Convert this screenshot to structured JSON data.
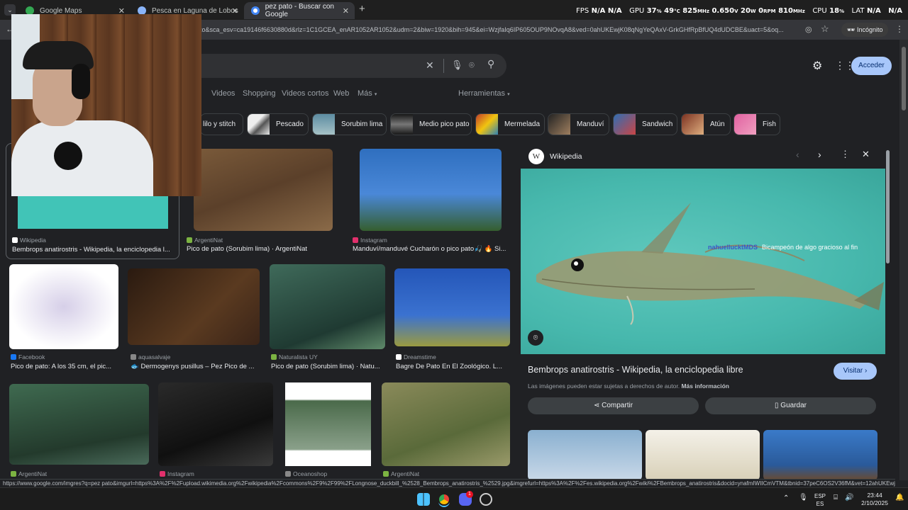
{
  "tabs": [
    {
      "title": "Google Maps",
      "active": false
    },
    {
      "title": "Pesca en Laguna de Lobos",
      "active": false
    },
    {
      "title": "pez pato - Buscar con Google",
      "active": true
    }
  ],
  "perf_overlay": {
    "fps_label": "FPS",
    "fps_val1": "N/A",
    "fps_val2": "N/A",
    "gpu_label": "GPU",
    "gpu_load": "37",
    "gpu_temp": "49",
    "gpu_clock": "825",
    "gpu_volt": "0.650",
    "gpu_power": "20",
    "gpu_fan": "0",
    "gpu_mem": "810",
    "cpu_label": "CPU",
    "cpu_load": "18",
    "lat_label": "LAT",
    "lat_val1": "N/A",
    "lat_val2": "N/A",
    "pct": "%",
    "degc": "°C",
    "mhz": "MHz",
    "v": "V",
    "w": "W",
    "rpm": "RPM"
  },
  "address_bar": {
    "url": "to&sca_esv=ca19146f6630880d&rlz=1C1GCEA_enAR1052AR1052&udm=2&biw=1920&bih=945&ei=WzjfaIq6IP605OUP9NOvqA8&ved=0ahUKEwjK08qNgYeQAxV-GrkGHfRpBfUQ4dUDCBE&uact=5&oq...",
    "incognito_label": "Incógnito"
  },
  "header": {
    "signin_label": "Acceder",
    "nav_tabs": [
      "Videos",
      "Shopping",
      "Videos cortos",
      "Web",
      "Más"
    ],
    "tools_label": "Herramientas"
  },
  "chips": [
    "lilo y stitch",
    "Pescado",
    "Sorubim lima",
    "Medio pico pato",
    "Mermelada",
    "Manduví",
    "Sandwich",
    "Atún",
    "Fish"
  ],
  "results": [
    {
      "source": "Wikipedia",
      "title": "Bembrops anatirostris - Wikipedia, la enciclopedia l..."
    },
    {
      "source": "ArgentiNat",
      "title": "Pico de pato (Sorubim lima) · ArgentiNat"
    },
    {
      "source": "Instagram",
      "title": "Manduví/manduvé Cucharón o pico pato🎣 🔥 Si..."
    },
    {
      "source": "Facebook",
      "title": "Pico de pato: A los 35 cm, el pic..."
    },
    {
      "source": "aquasalvaje",
      "title": "🐟 Dermogenys pusillus – Pez Pico de ..."
    },
    {
      "source": "Naturalista UY",
      "title": "Pico de pato (Sorubim lima) · Natu..."
    },
    {
      "source": "Dreamstime",
      "title": "Bagre De Pato En El Zoológico. L..."
    },
    {
      "source": "ArgentiNat",
      "title": ""
    },
    {
      "source": "Instagram",
      "title": ""
    },
    {
      "source": "Oceanoshop",
      "title": ""
    },
    {
      "source": "ArgentiNat",
      "title": ""
    }
  ],
  "panel": {
    "source": "Wikipedia",
    "title": "Bembrops anatirostris - Wikipedia, la enciclopedia libre",
    "visit_label": "Visitar",
    "copyright": "Las imágenes pueden estar sujetas a derechos de autor.",
    "more_info": "Más información",
    "share_label": "Compartir",
    "save_label": "Guardar",
    "watermark1": "nahuellucktMDS",
    "watermark2": "Bicampeón de algo gracioso al fin"
  },
  "status_url": "https://www.google.com/imgres?q=pez pato&imgurl=https%3A%2F%2Fupload.wikimedia.org%2Fwikipedia%2Fcommons%2F9%2F99%2FLongnose_duckbill_%2528_Bembrops_anatirostris_%2529.jpg&imgrefurl=https%3A%2F%2Fes.wikipedia.org%2Fwiki%2FBembrops_anatirostris&docid=ynafmIWIICmVTM&tbnid=37peC6OS2V36fM&vet=12ahUKEwjs...",
  "taskbar": {
    "lang1": "ESP",
    "lang2": "ES",
    "time": "23:44",
    "date": "2/10/2025",
    "discord_badge": "1"
  }
}
